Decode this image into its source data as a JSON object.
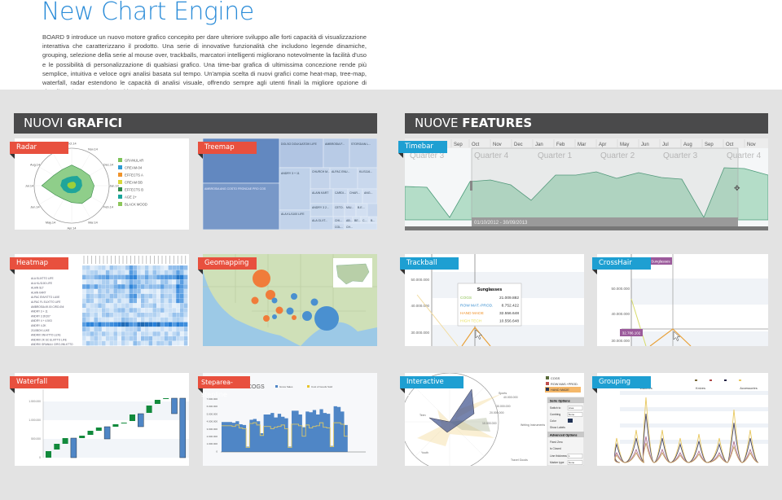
{
  "title": "New Chart Engine",
  "intro": "BOARD 9 introduce un nuovo motore grafico concepito per dare ulteriore sviluppo alle forti capacità di visualizzazione interattiva che caratterizzano il prodotto. Una serie di innovative funzionalità che includono legende dinamiche, grouping, selezione della serie al mouse over, trackballs, marcatori intelligenti migliorano notevolmente la facilità d'uso e le possibilità di personalizzazione di qualsiasi grafico. Una time-bar grafica di ultimissima concezione rende più semplice, intuitiva e veloce ogni analisi basata sul tempo.  Un'ampia scelta di nuovi grafici come heat-map, tree-map, waterfall, radar estendono le capacità di analisi visuale, offrendo sempre agli utenti finali la migliore opzione di visualizzazione per esplorare i loro dati.",
  "sections": {
    "left": {
      "light": "NUOVI ",
      "bold": "GRAFICI"
    },
    "right": {
      "light": "NUOVE ",
      "bold": "FEATURES"
    }
  },
  "colors": {
    "red_ribbon": "#e8503e",
    "blue_ribbon": "#1e9fd2",
    "header": "#4a4a4b",
    "title": "#2b8cd8"
  },
  "radar": {
    "label": "Radar",
    "axes": [
      "Oct.14",
      "Nov.14",
      "Dec.14",
      "Jan.14",
      "Feb.14",
      "Mar.14",
      "Apr.14",
      "May.14",
      "Jun.14",
      "Jul.14",
      "Aug.14",
      "Sep.14"
    ],
    "legend": [
      {
        "name": "GRANULAR",
        "color": "#7dc35a"
      },
      {
        "name": "CREAM-04",
        "color": "#2e9bd2"
      },
      {
        "name": "EFFECTS A",
        "color": "#f0932b"
      },
      {
        "name": "CREAM BB",
        "color": "#d9d83a"
      },
      {
        "name": "EFFECTS B",
        "color": "#2f8a4a"
      },
      {
        "name": "AGE 2+",
        "color": "#1aa59a"
      },
      {
        "name": "BLACK MOOD",
        "color": "#8cc65a"
      }
    ]
  },
  "treemap": {
    "label": "Treemap",
    "cells": [
      "DOLSO DOLKUATOIK LIFE",
      "AMBROSIA F...",
      "STORGIAN L...",
      "AMBROSIA ANG COSTO FRONCAE PRO COS",
      "ALAIN SLT",
      "CHURCH M...",
      "ALPAC ENU...",
      "KLIS116...",
      "ANDRY 3 + 11",
      "ALAIN KART",
      "CARDI...",
      "CHAR...",
      "ANG...",
      "ANDRY 3 2...",
      "CETO...",
      "MIU...",
      "B.E...",
      "CO...",
      "ALA KL/1100 LIFE",
      "CHI...",
      "AB...",
      "BE...",
      "C...",
      "B...",
      "ALA GLXT...",
      "COL...",
      "CH..."
    ]
  },
  "timebar": {
    "label": "Timebar",
    "months": [
      "Sep",
      "Oct",
      "Nov",
      "Dec",
      "Jan",
      "Feb",
      "Mar",
      "Apr",
      "May",
      "Jun",
      "Jul",
      "Aug",
      "Sep",
      "Oct",
      "Nov"
    ],
    "quarters": [
      "Quarter 3",
      "Quarter 4",
      "Quarter 1",
      "Quarter 2",
      "Quarter 3",
      "Quarter 4"
    ],
    "range": "01/10/2012 - 30/09/2013"
  },
  "heatmap": {
    "label": "Heatmap",
    "rows": [
      "ALA ELIXTTO LIFE",
      "ALA KL/1100 LIFE",
      "ALAIN SLT",
      "ALAIN KART",
      "ALPAC ENVXTTO LUXE",
      "ALPAC FL ELIXTTO LIFE",
      "AMBROSIA 49.00 CIRO-0NI",
      "ANDRY 3 + 11",
      "ANDRY 3 2K207",
      "ANDRY 4 + 4.5X3",
      "ANDRY 4.2K",
      "2110BOX LUXE",
      "ANDRIX 0NI-KTTO LUXE",
      "ANDRIX 2K SC ELIXTTO LIFE",
      "ANDRIX GRANULI CIRO-0NI-KTTO"
    ]
  },
  "geomapping": {
    "label": "Geomapping"
  },
  "trackball": {
    "label": "Trackball",
    "yticks": [
      "50.000.000",
      "40.000.000",
      "30.000.000"
    ],
    "tooltip": {
      "title": "Sunglasses",
      "rows": [
        {
          "name": "COGS",
          "value": "21.009.882",
          "color": "#8cc152"
        },
        {
          "name": "ROW MAT.-PROD.",
          "value": "8.752.422",
          "color": "#3a8fd0"
        },
        {
          "name": "HAND MADE",
          "value": "32.556.648",
          "color": "#f0932b"
        },
        {
          "name": "HIGH TECH",
          "value": "10.556.648",
          "color": "#e8e05a"
        }
      ]
    }
  },
  "crosshair": {
    "label": "CrossHair",
    "yticks": [
      "50.000.000",
      "40.000.000",
      "30.000.000"
    ],
    "x_marker": "Sunglasses",
    "y_marker": "32.786.102"
  },
  "waterfall": {
    "label": "Waterfall",
    "yticks": [
      "1.500.000",
      "1.000.000",
      "500.000",
      "0"
    ]
  },
  "steparea": {
    "label": "Steparea-stepline",
    "title": "COGS",
    "legend": [
      "Gross Sales",
      "Cost of Goods Sold"
    ],
    "yticks": [
      "7.000.000",
      "6.000.000",
      "5.000.000",
      "4.000.000",
      "3.000.000",
      "2.000.000",
      "1.000.000",
      "0"
    ]
  },
  "interactive_legend": {
    "label": "Interactive Legend",
    "items": [
      "COGS",
      "ROW MAS.+PROD.",
      "HAND MADE"
    ],
    "radar_labels": [
      "Sports",
      "40.000.000",
      "30.000.000",
      "20.000.000",
      "10.000.000",
      "Writing Instruments",
      "Travel Goods",
      "Youth",
      "Teen"
    ],
    "panel": {
      "series_title": "Serie Options",
      "switch_label": "Switch to",
      "switch_value": "Area",
      "combing_label": "Combing",
      "combing_value": "None",
      "color_label": "Color",
      "show_labels": "Show Labels",
      "advanced_title": "Advanced Options",
      "fixed_zero": "Fixed Zero",
      "is_closed": "Is Closed",
      "line_thickness": "Line thickness",
      "line_value": "1",
      "marker_label": "Marker type",
      "marker_value": "None"
    }
  },
  "grouping": {
    "label": "Grouping",
    "groups": [
      "Watches",
      "Knives",
      "Accessories"
    ]
  }
}
